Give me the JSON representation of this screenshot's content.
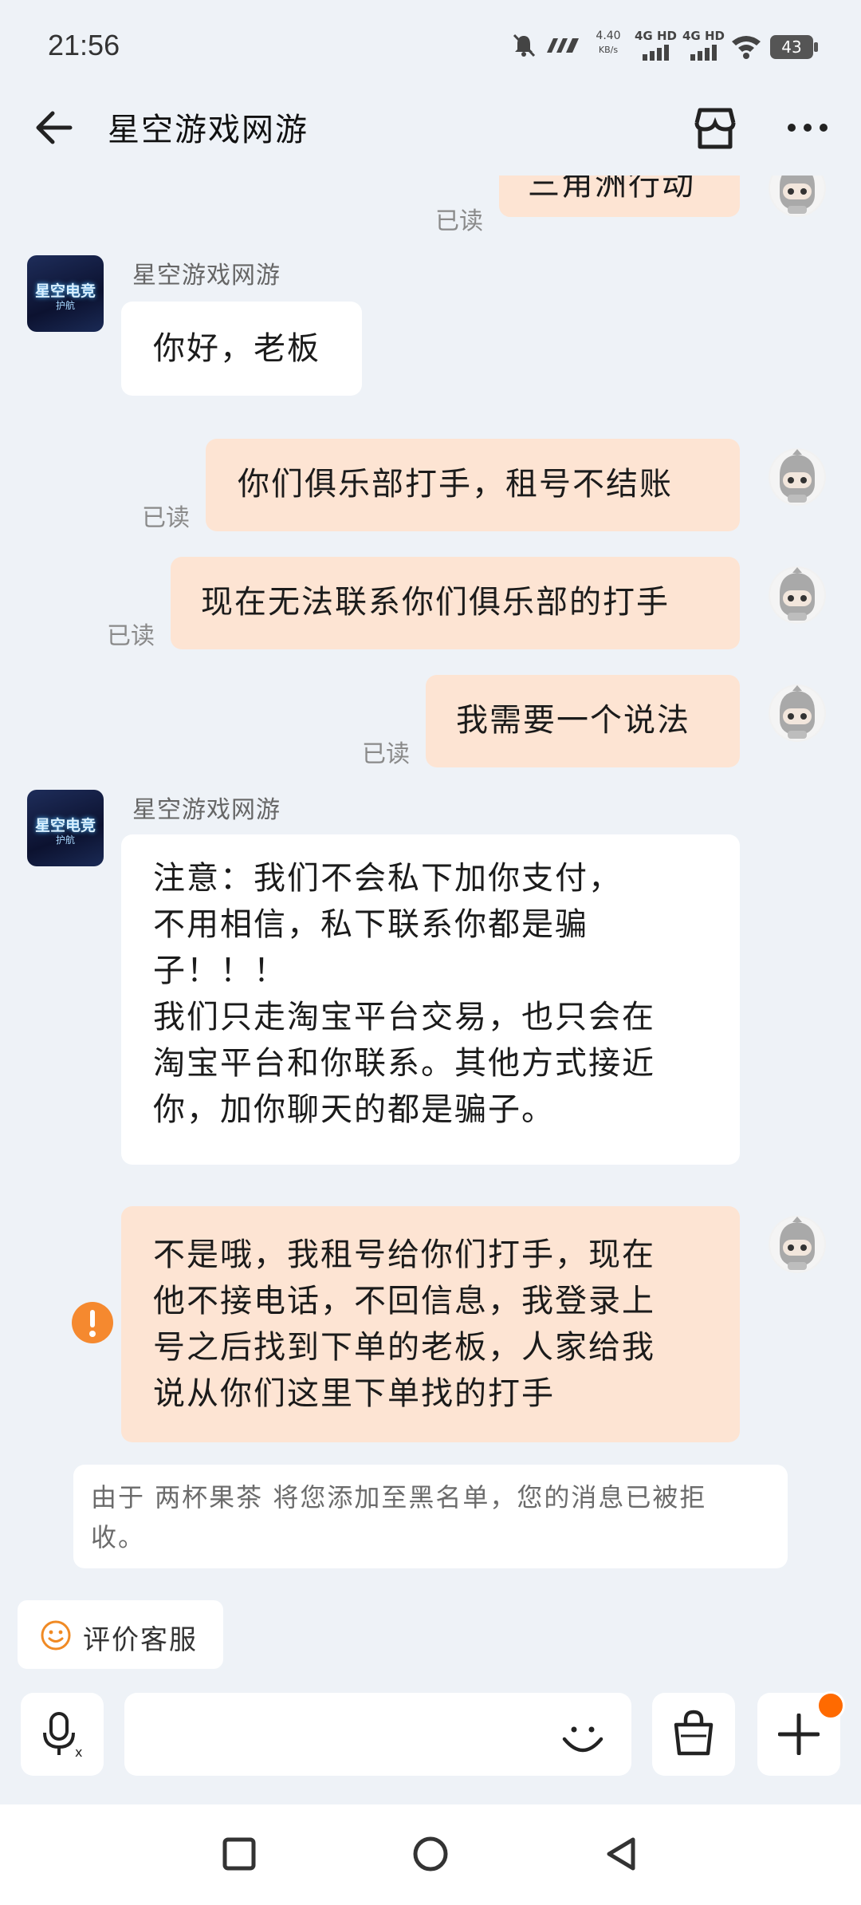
{
  "status_bar": {
    "time": "21:56",
    "net_speed": "4.40",
    "net_unit": "KB/s",
    "signal1": "4G HD",
    "signal2": "4G HD",
    "battery": "43"
  },
  "header": {
    "title": "星空游戏网游"
  },
  "shop_avatar": {
    "line1": "星空电竞",
    "line2": "护航"
  },
  "messages": [
    {
      "side": "out",
      "text": "三角洲行动",
      "status": "已读"
    },
    {
      "side": "in",
      "sender": "星空游戏网游",
      "text": "你好，老板"
    },
    {
      "side": "out",
      "text": "你们俱乐部打手，租号不结账",
      "status": "已读"
    },
    {
      "side": "out",
      "text": "现在无法联系你们俱乐部的打手",
      "status": "已读"
    },
    {
      "side": "out",
      "text": "我需要一个说法",
      "status": "已读"
    },
    {
      "side": "in",
      "sender": "星空游戏网游",
      "lines": [
        "注意：我们不会私下加你支付，",
        "不用相信，私下联系你都是骗",
        "子！！！",
        "我们只走淘宝平台交易，也只会在",
        "淘宝平台和你联系。其他方式接近",
        "你，加你聊天的都是骗子。"
      ]
    },
    {
      "side": "out",
      "failed": true,
      "lines": [
        "不是哦，我租号给你们打手，现在",
        "他不接电话，不回信息，我登录上",
        "号之后找到下单的老板，人家给我",
        "说从你们这里下单找的打手"
      ]
    }
  ],
  "system_notice": {
    "lines": [
      "由于 两杯果茶 将您添加至黑名单，您的消息已被拒",
      "收。"
    ]
  },
  "quick_action": {
    "label": "评价客服"
  },
  "colors": {
    "background": "#eef2f7",
    "outgoing_bubble": "#fde4d3",
    "incoming_bubble": "#ffffff",
    "error_badge": "#f5892f",
    "notification_dot": "#ff6a00"
  }
}
